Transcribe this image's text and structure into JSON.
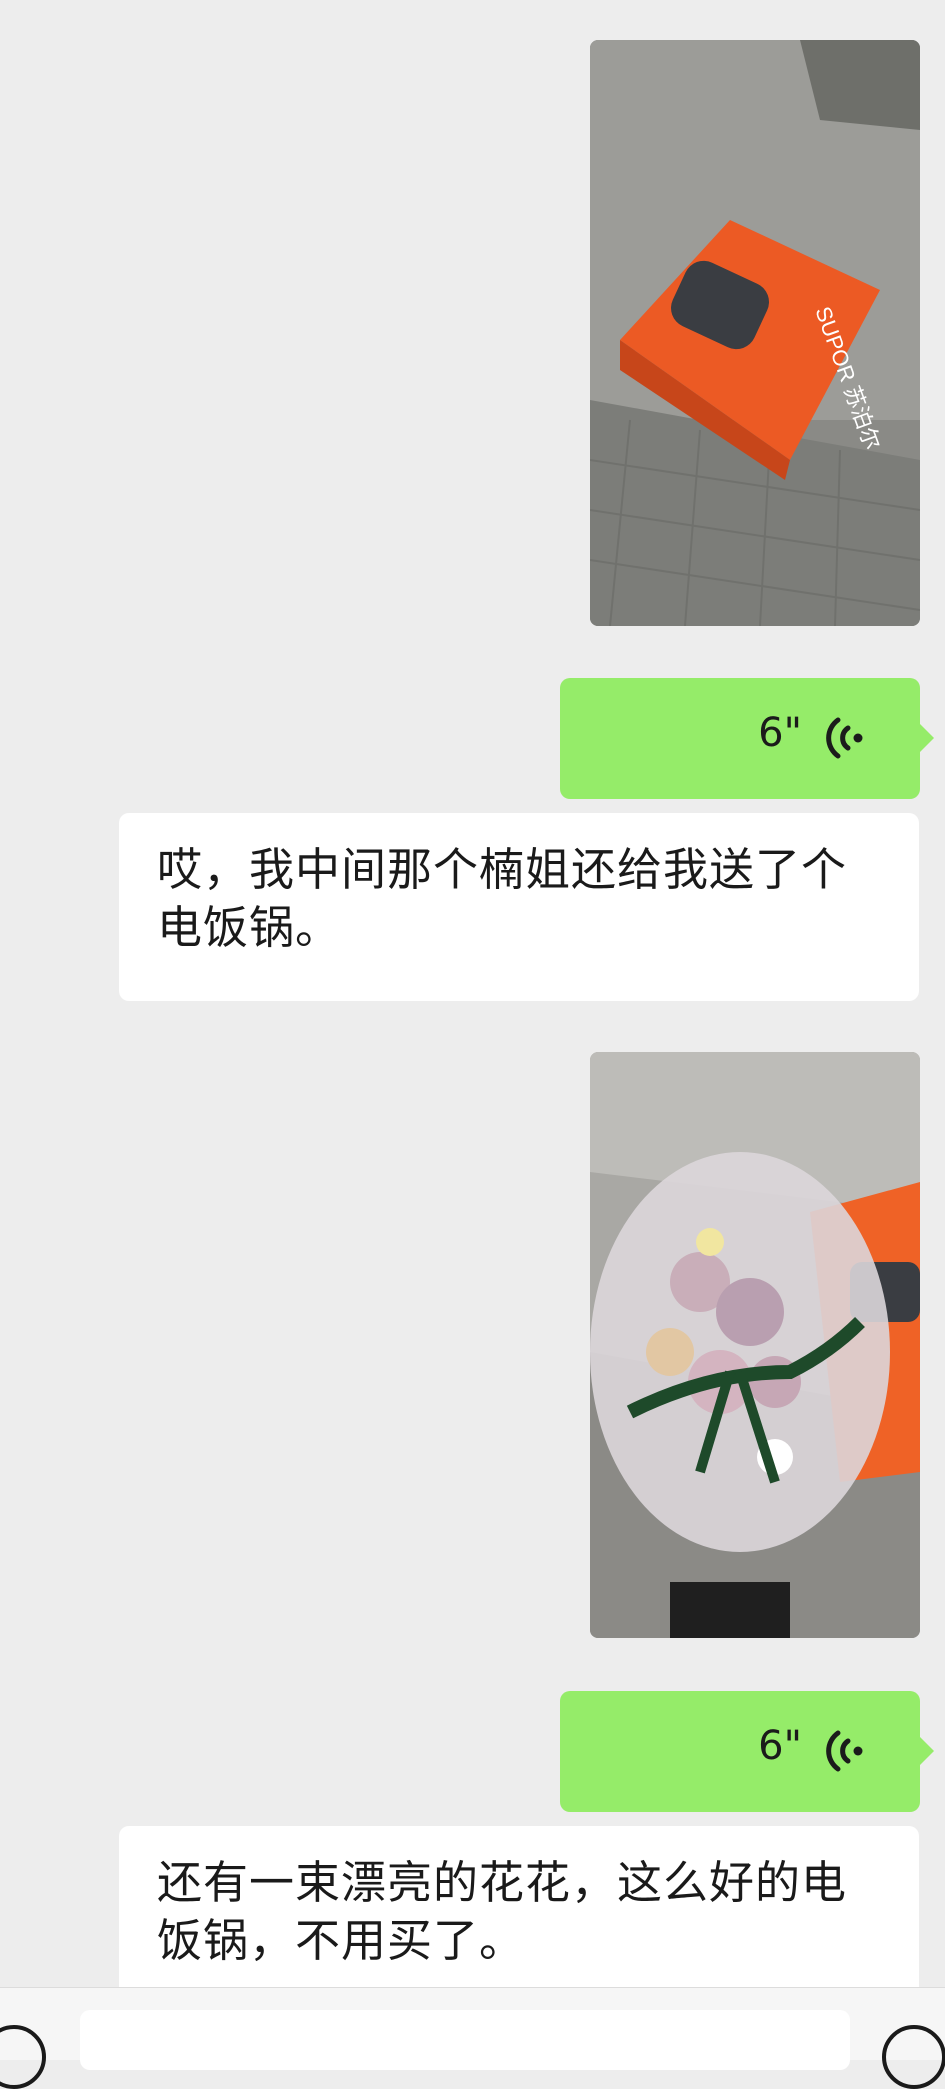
{
  "messages": [
    {
      "type": "image",
      "sender": "other",
      "desc": "photo-rice-cooker-box",
      "box_brand": "SUPOR 苏泊尔"
    },
    {
      "type": "voice",
      "sender": "me",
      "duration": "6\""
    },
    {
      "type": "text",
      "sender": "other",
      "text": "哎，我中间那个楠姐还给我送了个电饭锅。"
    },
    {
      "type": "image",
      "sender": "other",
      "desc": "photo-flower-bouquet"
    },
    {
      "type": "voice",
      "sender": "me",
      "duration": "6\""
    },
    {
      "type": "text",
      "sender": "other",
      "text": "还有一束漂亮的花花，这么好的电饭锅，不用买了。"
    }
  ],
  "input_bar": {
    "left_icon": "voice-input-icon",
    "right_icon": "emoji-icon",
    "value": ""
  },
  "colors": {
    "background": "#ededed",
    "my_bubble": "#95ec69",
    "their_bubble": "#ffffff"
  }
}
